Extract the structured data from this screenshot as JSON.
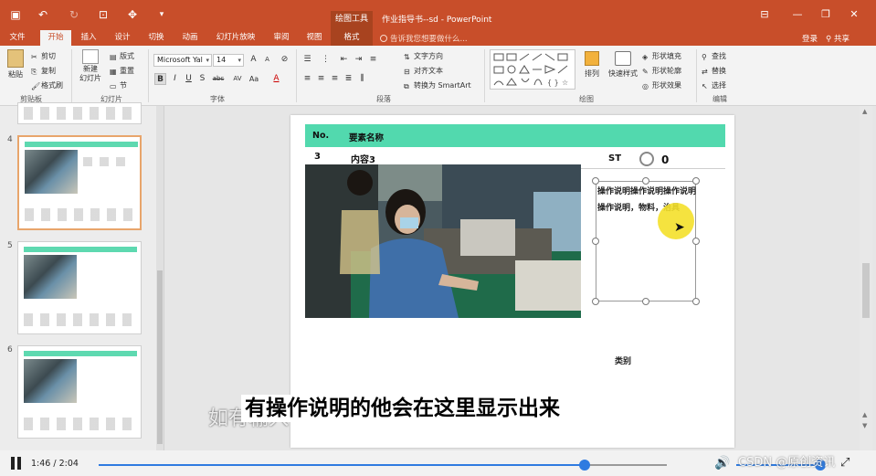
{
  "app": {
    "title": "作业指导书--sd - PowerPoint",
    "context_label": "绘图工具",
    "quick_access_icons": [
      "save-icon",
      "undo-icon",
      "redo-icon",
      "start-slideshow-icon",
      "touch-mode-icon",
      "customize-icon"
    ],
    "window_icons": [
      "ribbon-options-icon",
      "minimize-icon",
      "restore-icon",
      "close-icon"
    ]
  },
  "tabs": [
    "文件",
    "开始",
    "插入",
    "设计",
    "切换",
    "动画",
    "幻灯片放映",
    "审阅",
    "视图",
    "格式"
  ],
  "active_tab": "开始",
  "tell_me": "告诉我您想要做什么...",
  "account": {
    "sign_in": "登录",
    "share": "共享"
  },
  "ribbon": {
    "clipboard": {
      "label": "剪贴板",
      "paste": "粘贴",
      "cut": "剪切",
      "copy": "复制",
      "format_painter": "格式刷"
    },
    "slides": {
      "label": "幻灯片",
      "new_slide": "新建\n幻灯片",
      "layout": "版式",
      "reset": "重置",
      "section": "节"
    },
    "font": {
      "label": "字体",
      "name": "Microsoft Yal",
      "size": "14",
      "buttons": [
        "B",
        "I",
        "U",
        "S",
        "abc",
        "AV",
        "Aa",
        "A"
      ]
    },
    "paragraph": {
      "label": "段落",
      "text_direction": "文字方向",
      "align_text": "对齐文本",
      "smartart": "转换为 SmartArt"
    },
    "drawing": {
      "label": "绘图",
      "arrange": "排列",
      "quick_styles": "快速样式",
      "shape_fill": "形状填充",
      "shape_outline": "形状轮廓",
      "shape_effects": "形状效果"
    },
    "editing": {
      "label": "编辑",
      "find": "查找",
      "replace": "替换",
      "select": "选择"
    }
  },
  "thumbnails": [
    {
      "number": "4",
      "selected": true
    },
    {
      "number": "5",
      "selected": false
    },
    {
      "number": "6",
      "selected": false
    }
  ],
  "slide": {
    "header_no": "No.",
    "header_name": "要素名称",
    "row_no": "3",
    "row_content": "内容3",
    "st_label": "ST",
    "st_value": "0",
    "textbox_text": "操作说明操作说明操作说明操作说明，物料，治具",
    "category_label": "类别"
  },
  "subtitles": {
    "ghost": "如有输入",
    "main": "有操作说明的他会在这里显示出来"
  },
  "player": {
    "time": "1:46 / 2:04",
    "progress": 0.855,
    "volume": 1.0
  },
  "watermark": "CSDN @原创资讯",
  "colors": {
    "brand": "#c84e2a",
    "header_bar": "#52d9ae",
    "accent": "#2f7be0"
  }
}
